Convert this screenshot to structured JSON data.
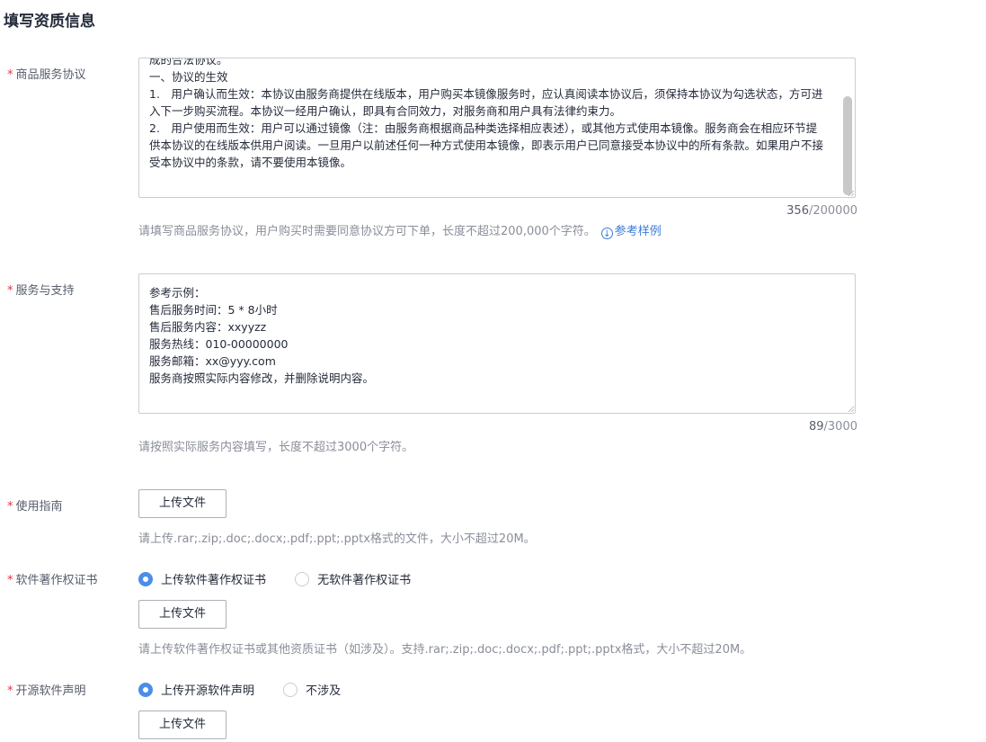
{
  "page": {
    "title": "填写资质信息"
  },
  "agreement": {
    "label": "商品服务协议",
    "lines": [
      "成的合法协议。",
      "一、协议的生效",
      "1.　用户确认而生效：本协议由服务商提供在线版本，用户购买本镜像服务时，应认真阅读本协议后，须保持本协议为勾选状态，方可进入下一步购买流程。本协议一经用户确认，即具有合同效力，对服务商和用户具有法律约束力。",
      "2.　用户使用而生效：用户可以通过镜像（注：由服务商根据商品种类选择相应表述），或其他方式使用本镜像。服务商会在相应环节提供本协议的在线版本供用户阅读。一旦用户以前述任何一种方式使用本镜像，即表示用户已同意接受本协议中的所有条款。如果用户不接受本协议中的条款，请不要使用本镜像。"
    ],
    "count": "356",
    "max": "/200000",
    "hint": "请填写商品服务协议，用户购买时需要同意协议方可下单，长度不超过200,000个字符。",
    "sample_link": "参考样例",
    "sample_icon": "download-circle-icon"
  },
  "support": {
    "label": "服务与支持",
    "lines": [
      "参考示例：",
      "售后服务时间：5 * 8小时",
      "售后服务内容：xxyyzz",
      "服务热线：010-00000000",
      "服务邮箱：xx@yyy.com",
      "服务商按照实际内容修改，并删除说明内容。"
    ],
    "count": "89",
    "max": "/3000",
    "hint": "请按照实际服务内容填写，长度不超过3000个字符。"
  },
  "guide": {
    "label": "使用指南",
    "upload_label": "上传文件",
    "hint": "请上传.rar;.zip;.doc;.docx;.pdf;.ppt;.pptx格式的文件，大小不超过20M。"
  },
  "copyright": {
    "label": "软件著作权证书",
    "options": [
      "上传软件著作权证书",
      "无软件著作权证书"
    ],
    "selected": 0,
    "upload_label": "上传文件",
    "hint": "请上传软件著作权证书或其他资质证书（如涉及）。支持.rar;.zip;.doc;.docx;.pdf;.ppt;.pptx格式，大小不超过20M。"
  },
  "opensource": {
    "label": "开源软件声明",
    "options": [
      "上传开源软件声明",
      "不涉及"
    ],
    "selected": 0,
    "upload_label": "上传文件"
  },
  "colors": {
    "required": "#e4333c",
    "accent": "#4b8ee8",
    "link": "#3a7cdb",
    "hint": "#8a8e99"
  }
}
